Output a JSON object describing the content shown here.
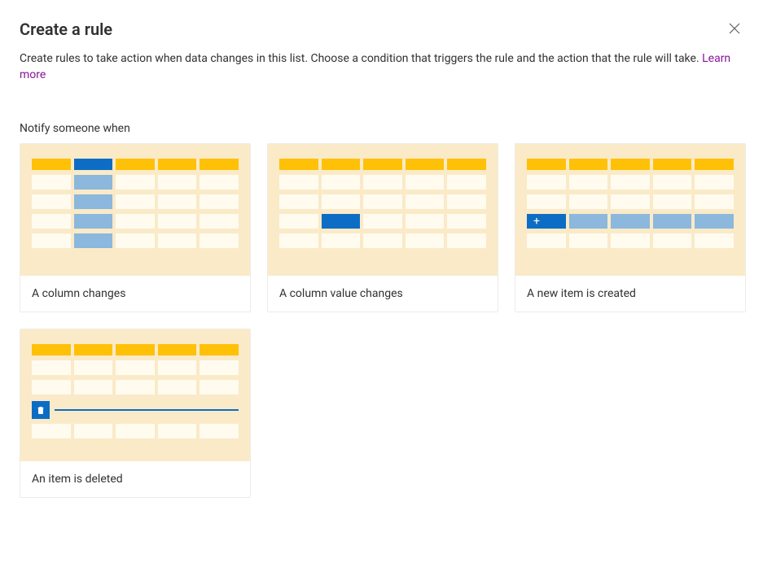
{
  "dialog": {
    "title": "Create a rule",
    "description": "Create rules to take action when data changes in this list. Choose a condition that triggers the rule and the action that the rule will take. ",
    "learn_more": "Learn more"
  },
  "section": {
    "label": "Notify someone when"
  },
  "cards": {
    "column_changes": "A column changes",
    "column_value_changes": "A column value changes",
    "new_item_created": "A new item is created",
    "item_deleted": "An item is deleted"
  }
}
